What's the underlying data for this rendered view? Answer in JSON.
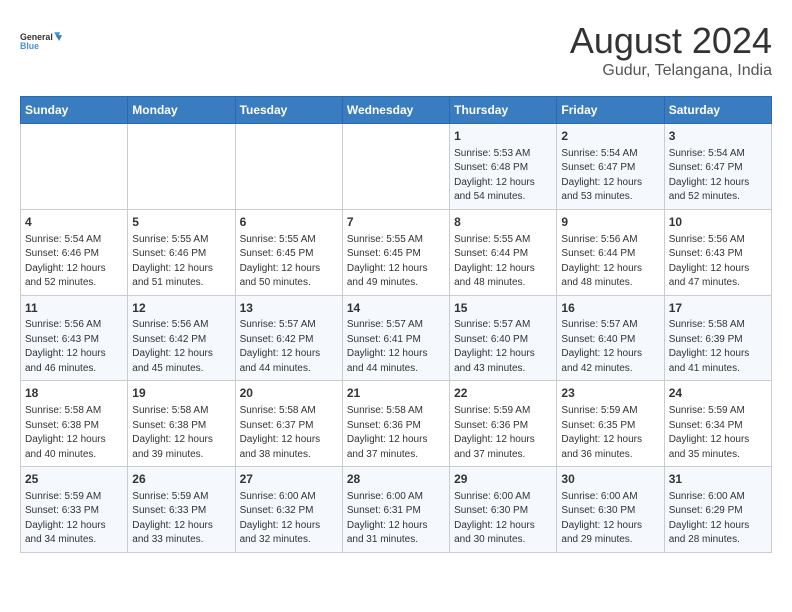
{
  "logo": {
    "line1": "General",
    "line2": "Blue"
  },
  "title": "August 2024",
  "subtitle": "Gudur, Telangana, India",
  "weekdays": [
    "Sunday",
    "Monday",
    "Tuesday",
    "Wednesday",
    "Thursday",
    "Friday",
    "Saturday"
  ],
  "weeks": [
    [
      {
        "day": "",
        "info": ""
      },
      {
        "day": "",
        "info": ""
      },
      {
        "day": "",
        "info": ""
      },
      {
        "day": "",
        "info": ""
      },
      {
        "day": "1",
        "info": "Sunrise: 5:53 AM\nSunset: 6:48 PM\nDaylight: 12 hours\nand 54 minutes."
      },
      {
        "day": "2",
        "info": "Sunrise: 5:54 AM\nSunset: 6:47 PM\nDaylight: 12 hours\nand 53 minutes."
      },
      {
        "day": "3",
        "info": "Sunrise: 5:54 AM\nSunset: 6:47 PM\nDaylight: 12 hours\nand 52 minutes."
      }
    ],
    [
      {
        "day": "4",
        "info": "Sunrise: 5:54 AM\nSunset: 6:46 PM\nDaylight: 12 hours\nand 52 minutes."
      },
      {
        "day": "5",
        "info": "Sunrise: 5:55 AM\nSunset: 6:46 PM\nDaylight: 12 hours\nand 51 minutes."
      },
      {
        "day": "6",
        "info": "Sunrise: 5:55 AM\nSunset: 6:45 PM\nDaylight: 12 hours\nand 50 minutes."
      },
      {
        "day": "7",
        "info": "Sunrise: 5:55 AM\nSunset: 6:45 PM\nDaylight: 12 hours\nand 49 minutes."
      },
      {
        "day": "8",
        "info": "Sunrise: 5:55 AM\nSunset: 6:44 PM\nDaylight: 12 hours\nand 48 minutes."
      },
      {
        "day": "9",
        "info": "Sunrise: 5:56 AM\nSunset: 6:44 PM\nDaylight: 12 hours\nand 48 minutes."
      },
      {
        "day": "10",
        "info": "Sunrise: 5:56 AM\nSunset: 6:43 PM\nDaylight: 12 hours\nand 47 minutes."
      }
    ],
    [
      {
        "day": "11",
        "info": "Sunrise: 5:56 AM\nSunset: 6:43 PM\nDaylight: 12 hours\nand 46 minutes."
      },
      {
        "day": "12",
        "info": "Sunrise: 5:56 AM\nSunset: 6:42 PM\nDaylight: 12 hours\nand 45 minutes."
      },
      {
        "day": "13",
        "info": "Sunrise: 5:57 AM\nSunset: 6:42 PM\nDaylight: 12 hours\nand 44 minutes."
      },
      {
        "day": "14",
        "info": "Sunrise: 5:57 AM\nSunset: 6:41 PM\nDaylight: 12 hours\nand 44 minutes."
      },
      {
        "day": "15",
        "info": "Sunrise: 5:57 AM\nSunset: 6:40 PM\nDaylight: 12 hours\nand 43 minutes."
      },
      {
        "day": "16",
        "info": "Sunrise: 5:57 AM\nSunset: 6:40 PM\nDaylight: 12 hours\nand 42 minutes."
      },
      {
        "day": "17",
        "info": "Sunrise: 5:58 AM\nSunset: 6:39 PM\nDaylight: 12 hours\nand 41 minutes."
      }
    ],
    [
      {
        "day": "18",
        "info": "Sunrise: 5:58 AM\nSunset: 6:38 PM\nDaylight: 12 hours\nand 40 minutes."
      },
      {
        "day": "19",
        "info": "Sunrise: 5:58 AM\nSunset: 6:38 PM\nDaylight: 12 hours\nand 39 minutes."
      },
      {
        "day": "20",
        "info": "Sunrise: 5:58 AM\nSunset: 6:37 PM\nDaylight: 12 hours\nand 38 minutes."
      },
      {
        "day": "21",
        "info": "Sunrise: 5:58 AM\nSunset: 6:36 PM\nDaylight: 12 hours\nand 37 minutes."
      },
      {
        "day": "22",
        "info": "Sunrise: 5:59 AM\nSunset: 6:36 PM\nDaylight: 12 hours\nand 37 minutes."
      },
      {
        "day": "23",
        "info": "Sunrise: 5:59 AM\nSunset: 6:35 PM\nDaylight: 12 hours\nand 36 minutes."
      },
      {
        "day": "24",
        "info": "Sunrise: 5:59 AM\nSunset: 6:34 PM\nDaylight: 12 hours\nand 35 minutes."
      }
    ],
    [
      {
        "day": "25",
        "info": "Sunrise: 5:59 AM\nSunset: 6:33 PM\nDaylight: 12 hours\nand 34 minutes."
      },
      {
        "day": "26",
        "info": "Sunrise: 5:59 AM\nSunset: 6:33 PM\nDaylight: 12 hours\nand 33 minutes."
      },
      {
        "day": "27",
        "info": "Sunrise: 6:00 AM\nSunset: 6:32 PM\nDaylight: 12 hours\nand 32 minutes."
      },
      {
        "day": "28",
        "info": "Sunrise: 6:00 AM\nSunset: 6:31 PM\nDaylight: 12 hours\nand 31 minutes."
      },
      {
        "day": "29",
        "info": "Sunrise: 6:00 AM\nSunset: 6:30 PM\nDaylight: 12 hours\nand 30 minutes."
      },
      {
        "day": "30",
        "info": "Sunrise: 6:00 AM\nSunset: 6:30 PM\nDaylight: 12 hours\nand 29 minutes."
      },
      {
        "day": "31",
        "info": "Sunrise: 6:00 AM\nSunset: 6:29 PM\nDaylight: 12 hours\nand 28 minutes."
      }
    ]
  ]
}
